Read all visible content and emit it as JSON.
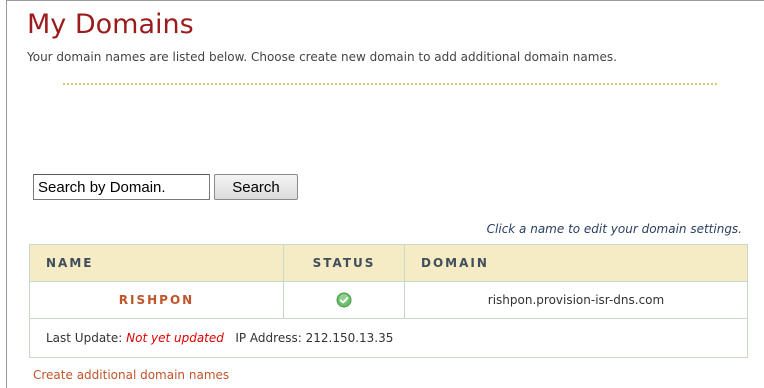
{
  "page": {
    "title": "My Domains",
    "subtitle": "Your domain names are listed below. Choose create new domain to add additional domain names."
  },
  "search": {
    "value": "Search by Domain.",
    "button_label": "Search"
  },
  "hint": "Click a name to edit your domain settings.",
  "table": {
    "headers": {
      "name": "NAME",
      "status": "STATUS",
      "domain": "DOMAIN"
    },
    "rows": [
      {
        "name": "RISHPON",
        "status_icon": "check-circle-icon",
        "domain": "rishpon.provision-isr-dns.com"
      }
    ],
    "footer": {
      "last_update_label": "Last Update:",
      "last_update_value": "Not yet updated",
      "ip_label": "IP Address:",
      "ip_value": "212.150.13.35"
    }
  },
  "create_link": "Create additional domain names",
  "colors": {
    "title": "#9b1c1c",
    "link": "#c0542a",
    "header_bg": "#f5ecc5",
    "status_ok": "#5cb85c",
    "warning_text": "#e00000"
  }
}
